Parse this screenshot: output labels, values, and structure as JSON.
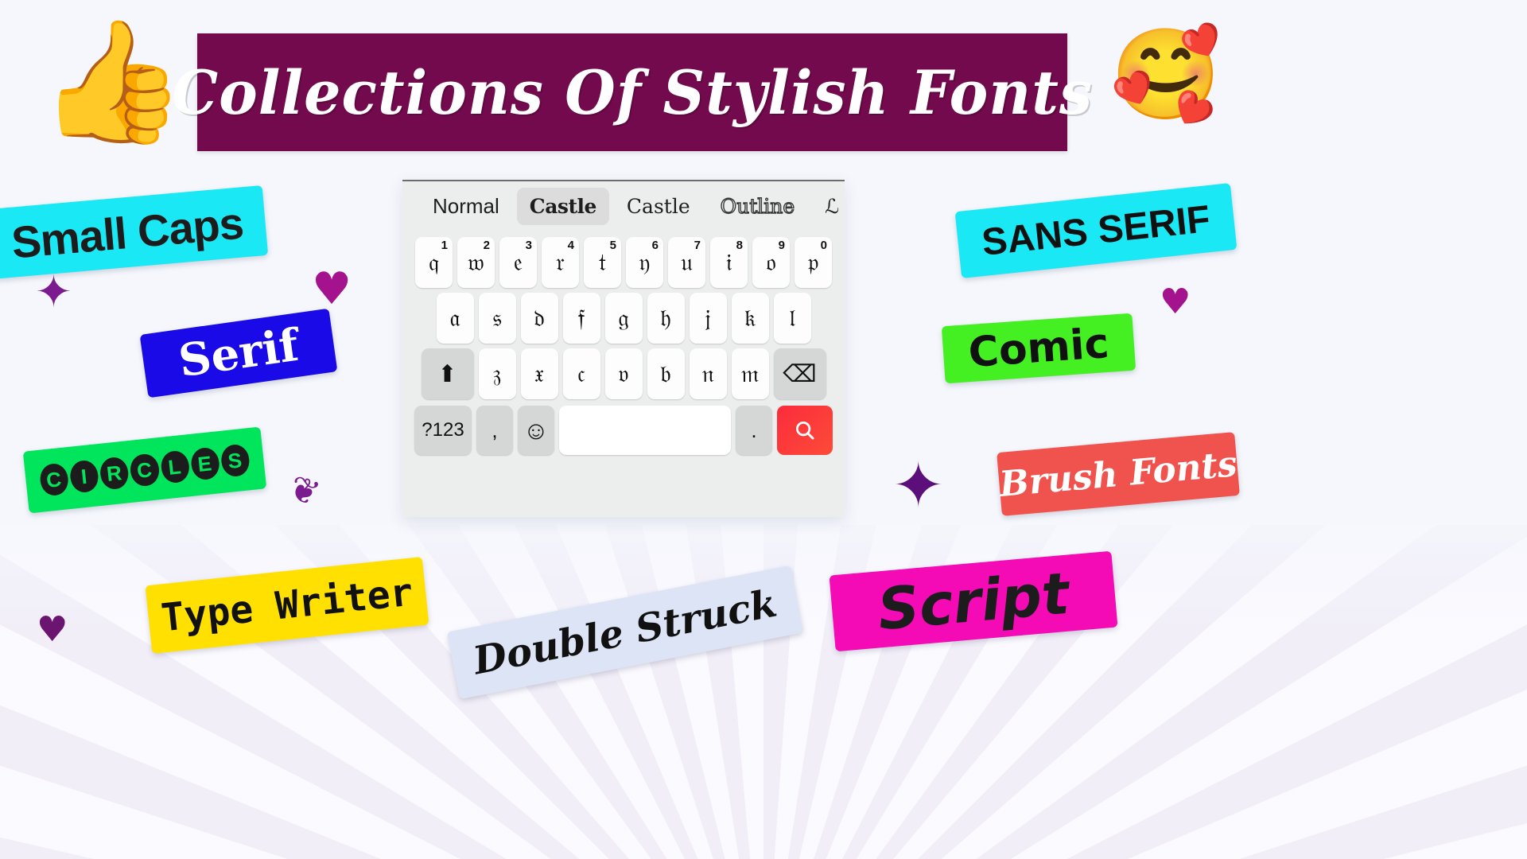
{
  "banner": {
    "title": "Collections Of Stylish Fonts",
    "background_color": "#730a4e",
    "text_color": "#ffffff"
  },
  "emojis": {
    "thumbs_up": "👍",
    "smiling_face_with_hearts": "🥰"
  },
  "keyboard": {
    "tabs": [
      {
        "label": "Normal",
        "style": "tab-normal",
        "selected": false
      },
      {
        "label": "Castle",
        "style": "tab-castle-bold",
        "selected": true
      },
      {
        "label": "Castle",
        "style": "tab-castle-light",
        "selected": false
      },
      {
        "label": "Outline",
        "style": "tab-outline",
        "selected": false
      },
      {
        "label": "ℒ",
        "style": "tab-cut",
        "selected": false
      }
    ],
    "row1": [
      {
        "key": "𝔮",
        "num": "1"
      },
      {
        "key": "𝔴",
        "num": "2"
      },
      {
        "key": "𝔢",
        "num": "3"
      },
      {
        "key": "𝔯",
        "num": "4"
      },
      {
        "key": "𝔱",
        "num": "5"
      },
      {
        "key": "𝔶",
        "num": "6"
      },
      {
        "key": "𝔲",
        "num": "7"
      },
      {
        "key": "𝔦",
        "num": "8"
      },
      {
        "key": "𝔬",
        "num": "9"
      },
      {
        "key": "𝔭",
        "num": "0"
      }
    ],
    "row2": [
      {
        "key": "𝔞"
      },
      {
        "key": "𝔰"
      },
      {
        "key": "𝔡"
      },
      {
        "key": "𝔣"
      },
      {
        "key": "𝔤"
      },
      {
        "key": "𝔥"
      },
      {
        "key": "𝔧"
      },
      {
        "key": "𝔨"
      },
      {
        "key": "𝔩"
      }
    ],
    "row3": [
      {
        "key": "𝔷"
      },
      {
        "key": "𝔵"
      },
      {
        "key": "𝔠"
      },
      {
        "key": "𝔳"
      },
      {
        "key": "𝔟"
      },
      {
        "key": "𝔫"
      },
      {
        "key": "𝔪"
      }
    ],
    "shift_label": "⬆",
    "backspace_label": "⌫",
    "row4": {
      "symbols_label": "?123",
      "comma_label": ",",
      "emoji_label": "☺",
      "space_label": "",
      "period_label": ".",
      "search_label": "search-icon"
    },
    "accent_color": "#fb2c3c"
  },
  "stickers": [
    {
      "id": "small-caps",
      "label": "Small Caps",
      "background": "#1ae8f5",
      "text_color": "#1c1c1c"
    },
    {
      "id": "serif",
      "label": "Serif",
      "background": "#1a0ae8",
      "text_color": "#ffffff"
    },
    {
      "id": "circles",
      "label": "CIRCLES",
      "background": "#00e55c",
      "text_color": "#111111"
    },
    {
      "id": "sans-serif",
      "label": "SANS SERIF",
      "background": "#1ae8f5",
      "text_color": "#111111"
    },
    {
      "id": "comic",
      "label": "Comic",
      "background": "#44f022",
      "text_color": "#111111"
    },
    {
      "id": "brush-fonts",
      "label": "Brush Fonts",
      "background": "#f0524d",
      "text_color": "#ffffff"
    },
    {
      "id": "type-writer",
      "label": "Type Writer",
      "background": "#ffe000",
      "text_color": "#111111"
    },
    {
      "id": "double-struck",
      "label": "Double Struck",
      "background": "#dde4f5",
      "text_color": "#111111"
    },
    {
      "id": "script",
      "label": "Script",
      "background": "#f50bb5",
      "text_color": "#1c1c1c"
    }
  ],
  "decorations": {
    "sparkle": "✦",
    "heart": "♥",
    "splat": "❦"
  }
}
